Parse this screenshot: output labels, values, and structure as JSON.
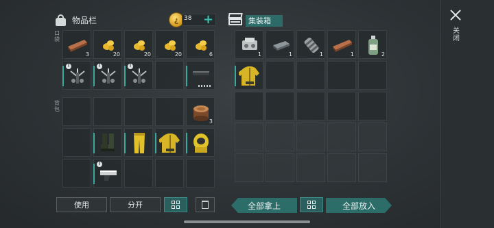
{
  "inventory": {
    "title": "物品栏",
    "coins": "38",
    "quick_label": "口袋",
    "backpack_label": "背包",
    "quick_row1": [
      {
        "item": "plank",
        "count": "3"
      },
      {
        "item": "corn",
        "count": "20"
      },
      {
        "item": "corn",
        "count": "20"
      },
      {
        "item": "corn",
        "count": "20"
      },
      {
        "item": "corn",
        "count": "6"
      }
    ],
    "quick_row2": [
      {
        "item": "crossbow-trap",
        "count": ""
      },
      {
        "item": "crossbow-trap",
        "count": ""
      },
      {
        "item": "crossbow-trap",
        "count": ""
      },
      {
        "item": "",
        "count": ""
      },
      {
        "item": "pistol",
        "count": ""
      }
    ],
    "backpack": [
      {
        "item": "",
        "count": ""
      },
      {
        "item": "",
        "count": ""
      },
      {
        "item": "",
        "count": ""
      },
      {
        "item": "",
        "count": ""
      },
      {
        "item": "log",
        "count": "3"
      },
      {
        "item": "",
        "count": ""
      },
      {
        "item": "boots",
        "count": ""
      },
      {
        "item": "pants",
        "count": ""
      },
      {
        "item": "jacket",
        "count": ""
      },
      {
        "item": "hazmat-hood",
        "count": ""
      },
      {
        "item": "",
        "count": ""
      },
      {
        "item": "chainsaw-gun",
        "count": ""
      },
      {
        "item": "",
        "count": ""
      },
      {
        "item": "",
        "count": ""
      },
      {
        "item": "",
        "count": ""
      }
    ]
  },
  "container": {
    "title": "集装箱",
    "row1": [
      {
        "item": "engine-part",
        "count": "1"
      },
      {
        "item": "iron-bar",
        "count": "1"
      },
      {
        "item": "spring-part",
        "count": "1"
      },
      {
        "item": "plank",
        "count": "1"
      },
      {
        "item": "bottle",
        "count": "2"
      }
    ],
    "row2": [
      {
        "item": "jacket-pack",
        "count": ""
      }
    ]
  },
  "buttons": {
    "use": "使用",
    "split": "分开",
    "take_all": "全部拿上",
    "put_all": "全部放入",
    "close": "关闭"
  },
  "colors": {
    "accent": "#3aa9a0",
    "teal_button": "#2c6d69"
  }
}
